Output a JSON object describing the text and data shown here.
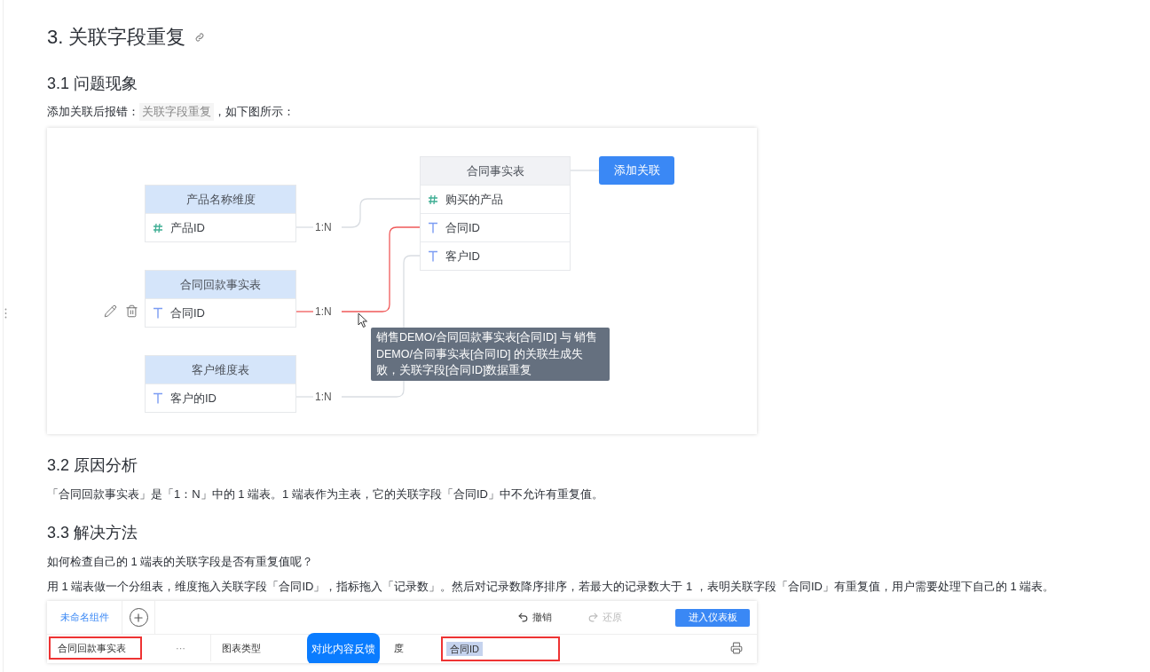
{
  "heading": "3. 关联字段重复",
  "s1": {
    "title": "3.1 问题现象",
    "intro": {
      "before": "添加关联后报错：",
      "code": "关联字段重复",
      "after": "，如下图所示："
    }
  },
  "diagram": {
    "tables": [
      {
        "kind": "dimension",
        "name": "产品名称维度",
        "fields": [
          {
            "kind": "number",
            "name": "产品ID"
          }
        ]
      },
      {
        "kind": "dimension",
        "name": "合同回款事实表",
        "fields": [
          {
            "kind": "text",
            "name": "合同ID"
          }
        ]
      },
      {
        "kind": "dimension",
        "name": "客户维度表",
        "fields": [
          {
            "kind": "text",
            "name": "客户的ID"
          }
        ]
      },
      {
        "kind": "fact",
        "name": "合同事实表",
        "fields": [
          {
            "kind": "number",
            "name": "购买的产品"
          },
          {
            "kind": "text",
            "name": "合同ID"
          },
          {
            "kind": "text",
            "name": "客户ID"
          }
        ]
      }
    ],
    "relations": [
      {
        "label": "1:N",
        "error": false
      },
      {
        "label": "1:N",
        "error": true
      },
      {
        "label": "1:N",
        "error": false
      }
    ],
    "add_button": "添加关联",
    "tooltip": "销售DEMO/合同回款事实表[合同ID] 与 销售DEMO/合同事实表[合同ID] 的关联生成失败，关联字段[合同ID]数据重复"
  },
  "s2": {
    "title": "3.2 原因分析",
    "text": "「合同回款事实表」是「1：N」中的 1 端表。1 端表作为主表，它的关联字段「合同ID」中不允许有重复值。"
  },
  "s3": {
    "title": "3.3 解决方法",
    "paragraphs": [
      "如何检查自己的 1 端表的关联字段是否有重复值呢？",
      "用 1 端表做一个分组表，维度拖入关联字段「合同ID」，指标拖入「记录数」。然后对记录数降序排序，若最大的记录数大于 1 ，表明关联字段「合同ID」有重复值，用户需要处理下自己的 1 端表。"
    ]
  },
  "screenshot": {
    "tab": "未命名组件",
    "undo": {
      "label": "撤销",
      "disabled": false
    },
    "redo": {
      "label": "还原",
      "disabled": true
    },
    "enter": "进入仪表板",
    "table": "合同回款事实表",
    "more": "···",
    "chart_type": "图表类型",
    "dimension_partial": "度",
    "field_chip": "合同ID"
  },
  "feedback": "对此内容反馈"
}
